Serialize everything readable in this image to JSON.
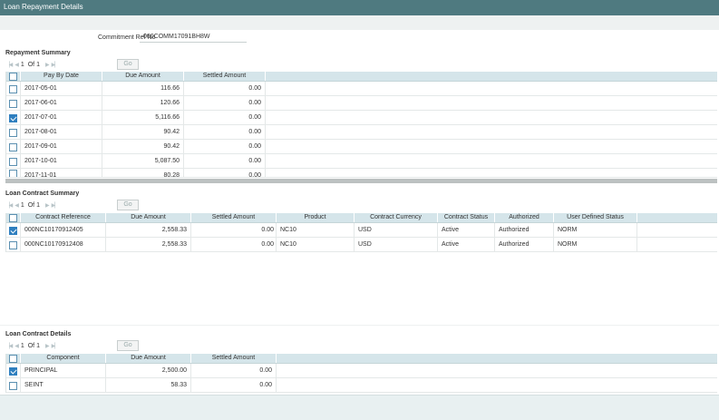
{
  "window": {
    "title": "Loan Repayment Details"
  },
  "commitment": {
    "label": "Commitment Ref No",
    "value": "000COMM17091BH8W"
  },
  "repayment_summary": {
    "title": "Repayment Summary",
    "pager": {
      "current": "1",
      "of_label": "Of",
      "total": "1",
      "go_label": "Go"
    },
    "columns": [
      "Pay By Date",
      "Due Amount",
      "Settled Amount"
    ],
    "rows": [
      {
        "checked": false,
        "date": "2017-05-01",
        "due": "116.66",
        "settled": "0.00"
      },
      {
        "checked": false,
        "date": "2017-06-01",
        "due": "120.66",
        "settled": "0.00"
      },
      {
        "checked": true,
        "date": "2017-07-01",
        "due": "5,116.66",
        "settled": "0.00"
      },
      {
        "checked": false,
        "date": "2017-08-01",
        "due": "90.42",
        "settled": "0.00"
      },
      {
        "checked": false,
        "date": "2017-09-01",
        "due": "90.42",
        "settled": "0.00"
      },
      {
        "checked": false,
        "date": "2017-10-01",
        "due": "5,087.50",
        "settled": "0.00"
      },
      {
        "checked": false,
        "date": "2017-11-01",
        "due": "80.28",
        "settled": "0.00"
      }
    ]
  },
  "loan_contract_summary": {
    "title": "Loan Contract Summary",
    "pager": {
      "current": "1",
      "of_label": "Of",
      "total": "1",
      "go_label": "Go"
    },
    "columns": [
      "Contract Reference",
      "Due Amount",
      "Settled Amount",
      "Product",
      "Contract Currency",
      "Contract Status",
      "Authorized",
      "User Defined Status"
    ],
    "rows": [
      {
        "checked": true,
        "ref": "000NC10170912405",
        "due": "2,558.33",
        "settled": "0.00",
        "product": "NC10",
        "currency": "USD",
        "status": "Active",
        "authorized": "Authorized",
        "uds": "NORM"
      },
      {
        "checked": false,
        "ref": "000NC10170912408",
        "due": "2,558.33",
        "settled": "0.00",
        "product": "NC10",
        "currency": "USD",
        "status": "Active",
        "authorized": "Authorized",
        "uds": "NORM"
      }
    ]
  },
  "loan_contract_details": {
    "title": "Loan Contract Details",
    "pager": {
      "current": "1",
      "of_label": "Of",
      "total": "1",
      "go_label": "Go"
    },
    "columns": [
      "Component",
      "Due Amount",
      "Settled Amount"
    ],
    "rows": [
      {
        "checked": true,
        "component": "PRINCIPAL",
        "due": "2,500.00",
        "settled": "0.00"
      },
      {
        "checked": false,
        "component": "SEINT",
        "due": "58.33",
        "settled": "0.00"
      }
    ]
  },
  "icons": {
    "first": "first-page-icon",
    "prev": "prev-page-icon",
    "next": "next-page-icon",
    "last": "last-page-icon"
  },
  "colors": {
    "titlebar": "#4f7a80",
    "header": "#d5e5ea",
    "checkbox": "#2f7fbf"
  }
}
